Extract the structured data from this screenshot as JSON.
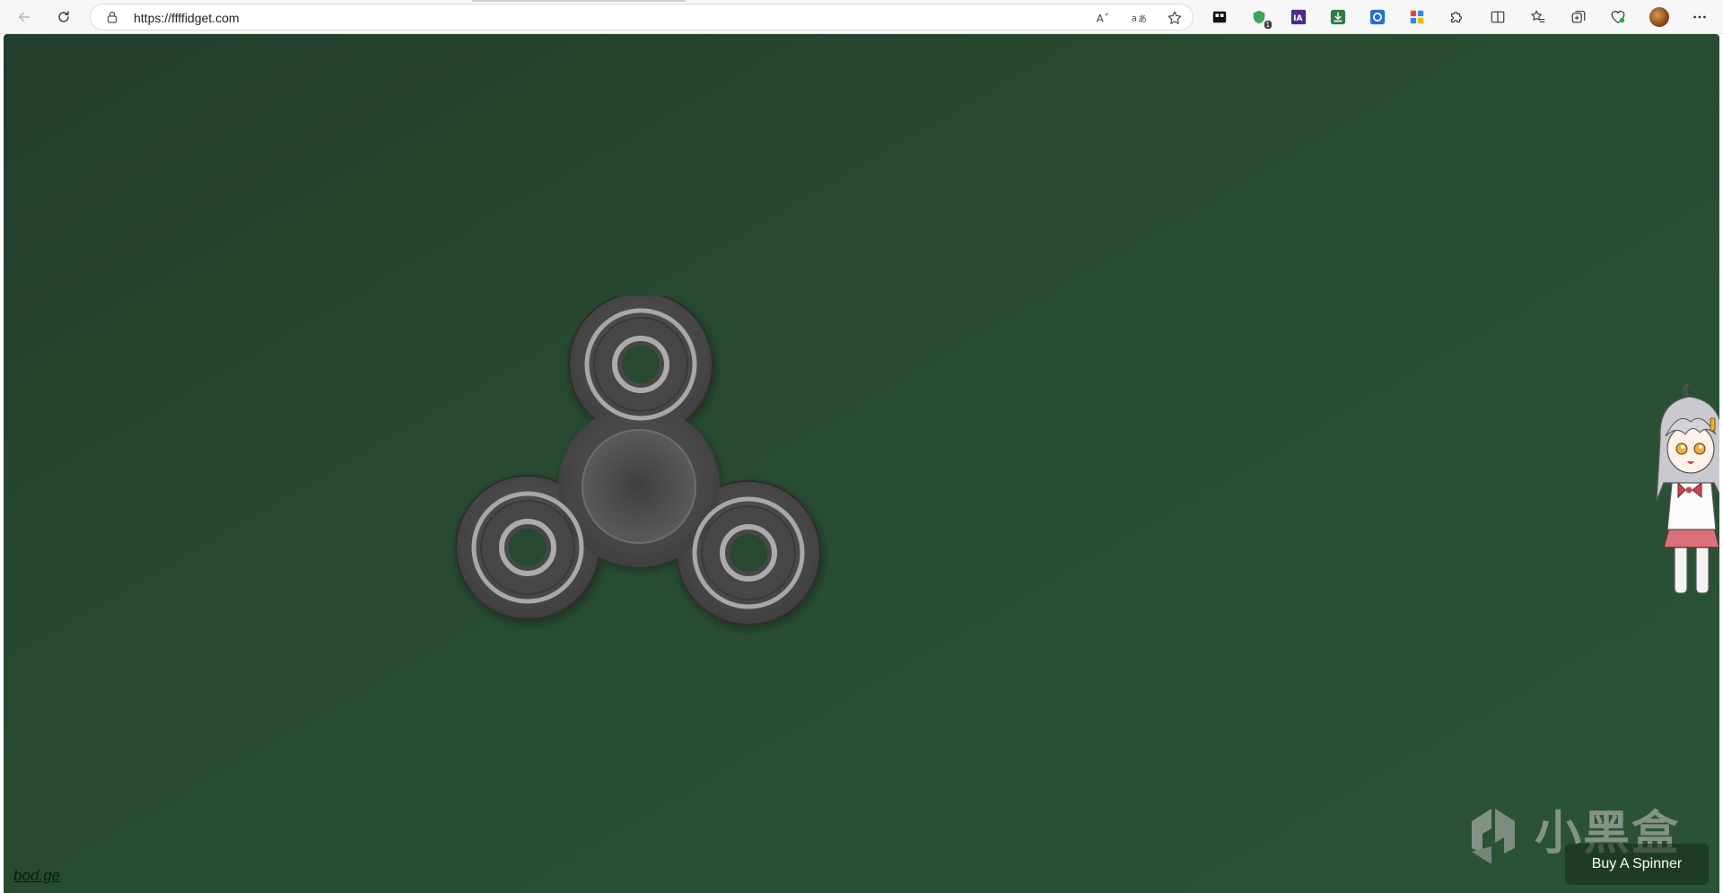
{
  "browser": {
    "url": "https://ffffidget.com",
    "extensions": [
      {
        "name": "black-cube-extension-icon"
      },
      {
        "name": "shield-extension-icon",
        "badge": "1"
      },
      {
        "name": "ia-extension-icon",
        "label": "IA"
      },
      {
        "name": "download-extension-icon"
      },
      {
        "name": "blue-square-extension-icon"
      },
      {
        "name": "grid-extension-icon"
      },
      {
        "name": "puzzle-extensions-icon"
      },
      {
        "name": "split-screen-icon"
      },
      {
        "name": "favorites-icon"
      },
      {
        "name": "collections-icon"
      },
      {
        "name": "heart-pulse-icon"
      }
    ],
    "colors": {
      "toolbar_bg": "#f7f7f7",
      "page_bg": "#27492f"
    }
  },
  "page": {
    "buy_button_label": "Buy A Spinner",
    "footer_link": "bod.ge",
    "watermark_text": "小黑盒",
    "spinner": {
      "color": "#4a4a4a",
      "ring_color": "#a8a8a8"
    }
  }
}
